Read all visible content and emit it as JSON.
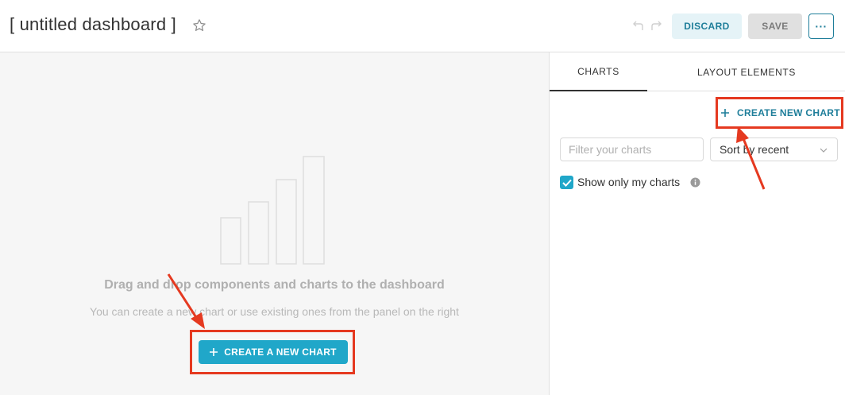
{
  "header": {
    "title": "[ untitled dashboard ]",
    "discard_label": "DISCARD",
    "save_label": "SAVE",
    "more_label": "···"
  },
  "canvas": {
    "empty_title": "Drag and drop components and charts to the dashboard",
    "empty_subtitle": "You can create a new chart or use existing ones from the panel on the right",
    "create_button_label": "CREATE A NEW CHART",
    "create_button_icon": "plus-icon"
  },
  "panel": {
    "tabs": [
      {
        "label": "CHARTS",
        "active": true
      },
      {
        "label": "LAYOUT ELEMENTS",
        "active": false
      }
    ],
    "create_link_label": "CREATE NEW CHART",
    "filter": {
      "placeholder": "Filter your charts",
      "value": ""
    },
    "sort": {
      "selected": "Sort by recent"
    },
    "show_only_mine": {
      "label": "Show only my charts",
      "checked": true
    }
  },
  "colors": {
    "accent": "#20a7c9",
    "accent_dark": "#1f7e9a",
    "annotation_red": "#e53920"
  }
}
